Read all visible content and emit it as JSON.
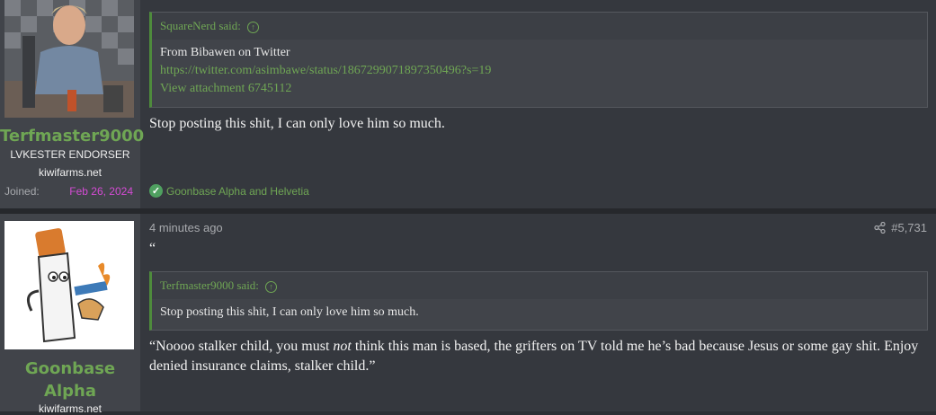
{
  "post1": {
    "username": "Terfmaster9000",
    "user_title": "LVKESTER ENDORSER",
    "site": "kiwifarms.net",
    "joined_label": "Joined:",
    "joined_date": "Feb 26, 2024",
    "quote": {
      "author": "SquareNerd said:",
      "line1": "From Bibawen on Twitter",
      "link": "https://twitter.com/asimbawe/status/1867299071897350496?s=19",
      "attachment": "View attachment 6745112"
    },
    "message": "Stop posting this shit, I can only love him so much.",
    "reaction": "Goonbase Alpha and Helvetia"
  },
  "post2": {
    "username_line1": "Goonbase",
    "username_line2": "Alpha",
    "site": "kiwifarms.net",
    "time": "4 minutes ago",
    "post_number": "#5,731",
    "stray_mark": "“",
    "quote": {
      "author": "Terfmaster9000 said:",
      "body": "Stop posting this shit, I can only love him so much."
    },
    "message_part1": "“Noooo stalker child, you must ",
    "message_em": "not",
    "message_part2": " think this man is based, the grifters on TV told me he’s bad because Jesus or some gay shit. Enjoy denied insurance claims, stalker child.”"
  },
  "icons": {
    "share": "share-icon",
    "up_arrow": "up-arrow-icon",
    "check": "check-icon"
  },
  "colors": {
    "accent_green": "#6fa654",
    "joined_pink": "#d44bd4",
    "background": "#35383e"
  }
}
